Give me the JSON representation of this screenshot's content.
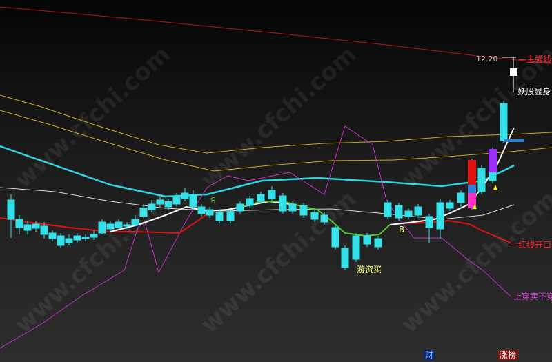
{
  "watermark": "www.cfchi.com",
  "colors": {
    "red_ma": "#e01010",
    "yellow_band": "#c8a820",
    "cyan_line": "#2dd6e0",
    "white_line": "#ffffff",
    "green_seg": "#4ec82c",
    "magenta_line": "#c830c8",
    "long_red": "#b81818",
    "up_candle": "#e01010",
    "down_candle": "#36e0e8",
    "yellow_text": "#ffff66",
    "violet_bar": "#9b30ff",
    "blue_bar": "#2f7fd8",
    "pink_bar": "#ff30c8"
  },
  "chart_data": {
    "type": "candlestick",
    "price_label": "12.20",
    "annotations": {
      "main_line": "主强线",
      "demon_stock": "妖股显身",
      "signal_s": "S",
      "signal_b": "B",
      "youzi": "游资买",
      "red_open": "红线开口主",
      "cross": "上穿卖下穿",
      "cai": "财",
      "zhangbang": "涨榜"
    }
  }
}
